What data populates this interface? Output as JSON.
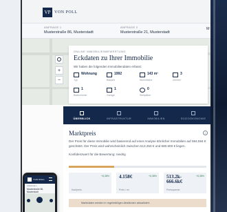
{
  "header": {
    "logo_mark": "VP",
    "logo_text": "VON POLL",
    "brand_color": "#13284a"
  },
  "addresses": {
    "first": {
      "label": "ANFRAGE 1",
      "value": "Musterstraße 86, Musterstadt"
    },
    "second": {
      "label": "ANFRAGE 2",
      "value": "Musterstraße 21, Musterstadt"
    },
    "third": {
      "label": "",
      "value": "M"
    }
  },
  "map": {
    "zoom_in": "+",
    "zoom_out": "−",
    "locate_icon": "target-icon"
  },
  "card": {
    "eyebrow": "ONLINE IMMOBILIENBEWERTUNG",
    "title": "Eckdaten zu Ihrer Immobilie",
    "subtitle": "Wir haben die folgenden Immobiliendaten erfasst:",
    "features": [
      {
        "value": "Wohnung",
        "label": "Typ",
        "icon": "building-icon"
      },
      {
        "value": "1992",
        "label": "Baujahr",
        "icon": "calendar-icon"
      },
      {
        "value": "143 m²",
        "label": "Wohnfläche",
        "icon": "area-icon"
      },
      {
        "value": "3",
        "label": "Zimmer",
        "icon": "bed-icon"
      },
      {
        "value": "1",
        "label": "Badezimmer",
        "icon": "bath-icon"
      },
      {
        "value": "1",
        "label": "Garage",
        "icon": "garage-icon"
      },
      {
        "value": "0",
        "label": "Stellplätze",
        "icon": "parking-icon"
      }
    ]
  },
  "tabs": [
    {
      "label": "ÜBERBLICK",
      "icon": "overview-icon",
      "active": true
    },
    {
      "label": "INFRASTRUKTUR",
      "icon": "infrastructure-icon",
      "active": false
    },
    {
      "label": "IMMOBILIEN",
      "icon": "house-icon",
      "active": false
    },
    {
      "label": "SOZIOÖKONOMIE",
      "icon": "people-icon",
      "active": false
    }
  ],
  "price": {
    "title": "Marktpreis",
    "description": "Der Preis für diese Immobilie wird basierend auf einer Analyse ähnlicher Immobilien auf 594.594 € geschätzt. Der Preis wird wahrscheinlich zwischen 513.250 € und 680.600 € liegen.",
    "confidence_label": "Konfidenzwert für die Bewertung: niedrig",
    "confidence_level": 0.33,
    "confidence_color": "#d9a55c",
    "boxes": [
      {
        "value": "",
        "change": "+6,38%",
        "label": "Kaufpreis"
      },
      {
        "value": "4.158€",
        "change": "+6,38%",
        "label": "Preis / m²"
      },
      {
        "value": "513.2k-666.6k€",
        "change": "+6,38%",
        "label": "Preisspanne"
      }
    ],
    "note": "Marktdaten werden in regelmäßigen Abständen aktualisiert."
  },
  "phone": {
    "logo_text": "VON POLL",
    "addr_label": "ANFRAGE 1",
    "addr_value": "Musterstraße 86, Musterstadt"
  }
}
